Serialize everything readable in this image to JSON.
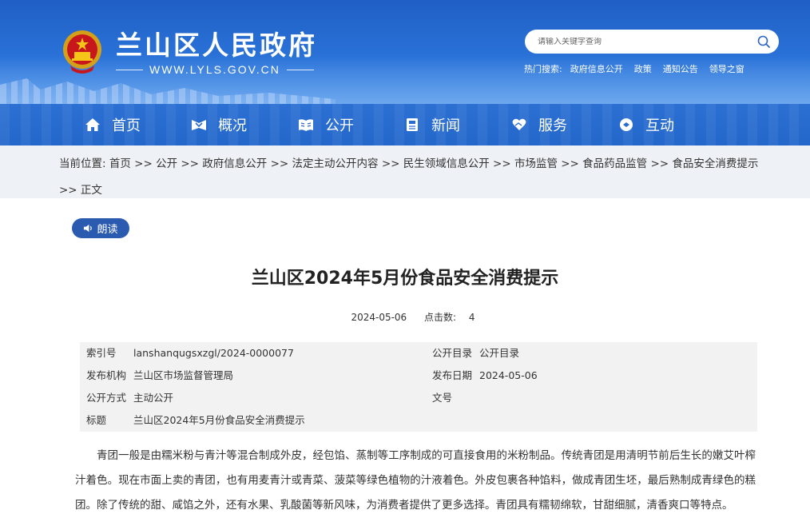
{
  "header": {
    "site_title": "兰山区人民政府",
    "site_url": "WWW.LYLS.GOV.CN",
    "search_placeholder": "请输入关键字查询",
    "hot_label": "热门搜索:",
    "hot_links": [
      "政府信息公开",
      "政策",
      "通知公告",
      "领导之窗"
    ],
    "accent_color": "#2a72d8"
  },
  "nav": {
    "items": [
      {
        "label": "首页",
        "icon": "home-icon"
      },
      {
        "label": "概况",
        "icon": "overview-icon"
      },
      {
        "label": "公开",
        "icon": "open-book-icon"
      },
      {
        "label": "新闻",
        "icon": "news-icon"
      },
      {
        "label": "服务",
        "icon": "service-heart-icon"
      },
      {
        "label": "互动",
        "icon": "chat-icon"
      }
    ]
  },
  "breadcrumb": {
    "prefix": "当前位置:",
    "items": [
      "首页",
      "公开",
      "政府信息公开",
      "法定主动公开内容",
      "民生领域信息公开",
      "市场监管",
      "食品药品监管",
      "食品安全消费提示",
      "正文"
    ],
    "separator": ">>"
  },
  "read_button": {
    "label": "朗读",
    "icon": "speaker-icon"
  },
  "article": {
    "title": "兰山区2024年5月份食品安全消费提示",
    "date": "2024-05-06",
    "hits_label": "点击数:",
    "hits": "4",
    "info": {
      "index_label": "索引号",
      "index_value": "lanshanqugsxzgl/2024-0000077",
      "catalog_label": "公开目录",
      "catalog_value": "公开目录",
      "org_label": "发布机构",
      "org_value": "兰山区市场监督管理局",
      "pubdate_label": "发布日期",
      "pubdate_value": "2024-05-06",
      "mode_label": "公开方式",
      "mode_value": "主动公开",
      "docno_label": "文号",
      "docno_value": "",
      "subject_label": "标题",
      "subject_value": "兰山区2024年5月份食品安全消费提示"
    },
    "paragraph": "青团一般是由糯米粉与青汁等混合制成外皮，经包馅、蒸制等工序制成的可直接食用的米粉制品。传统青团是用清明节前后生长的嫩艾叶榨汁着色。现在市面上卖的青团，也有用麦青汁或青菜、菠菜等绿色植物的汁液着色。外皮包裹各种馅料，做成青团生坯，最后熟制成青绿色的糕团。除了传统的甜、咸馅之外，还有水果、乳酸菌等新风味，为消费者提供了更多选择。青团具有糯韧绵软，甘甜细腻，清香爽口等特点。"
  }
}
